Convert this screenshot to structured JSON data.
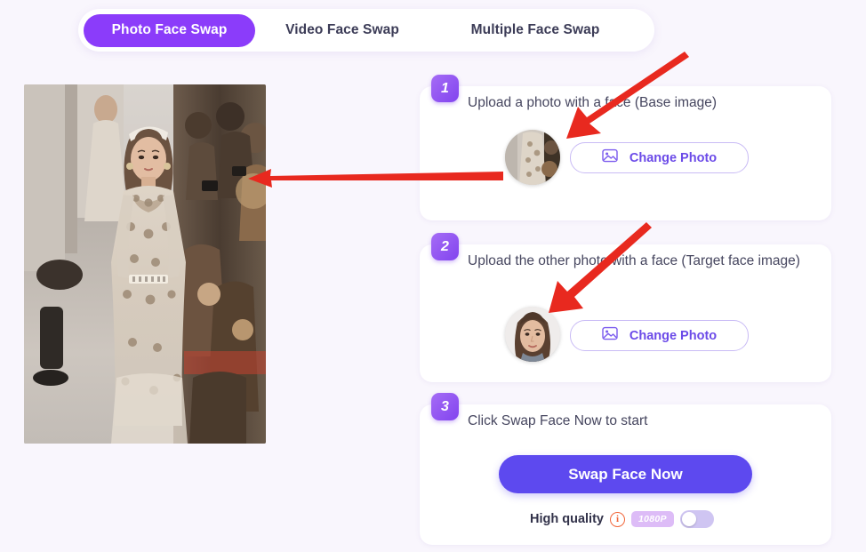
{
  "tabs": [
    {
      "label": "Photo Face Swap",
      "active": true
    },
    {
      "label": "Video Face Swap",
      "active": false
    },
    {
      "label": "Multiple Face Swap",
      "active": false
    }
  ],
  "preview": {
    "alt": "Model in embellished sheer gown walking a fashion runway"
  },
  "steps": [
    {
      "number": "1",
      "title": "Upload a photo with a face (Base image)",
      "button_label": "Change Photo",
      "thumb_alt": "Runway gown photo thumbnail"
    },
    {
      "number": "2",
      "title": "Upload the other photo with a face (Target face image)",
      "button_label": "Change Photo",
      "thumb_alt": "Young woman portrait thumbnail"
    },
    {
      "number": "3",
      "title": "Click Swap Face Now to start",
      "action_label": "Swap Face Now",
      "quality_label": "High quality",
      "info_glyph": "i",
      "resolution_badge": "1080P",
      "toggle_state": "off"
    }
  ],
  "icons": {
    "change_photo": "image-icon",
    "info": "info-circle-icon"
  },
  "colors": {
    "accent_purple": "#8b3cfa",
    "action_blue": "#5d49ef",
    "page_background": "#f9f6fd",
    "annotation_red": "#e8291f",
    "badge_lilac": "#ddbcf7",
    "info_orange": "#f1663a"
  },
  "annotations": [
    {
      "name": "arrow-to-base-thumb"
    },
    {
      "name": "arrow-to-preview-image"
    },
    {
      "name": "arrow-to-target-thumb"
    }
  ]
}
